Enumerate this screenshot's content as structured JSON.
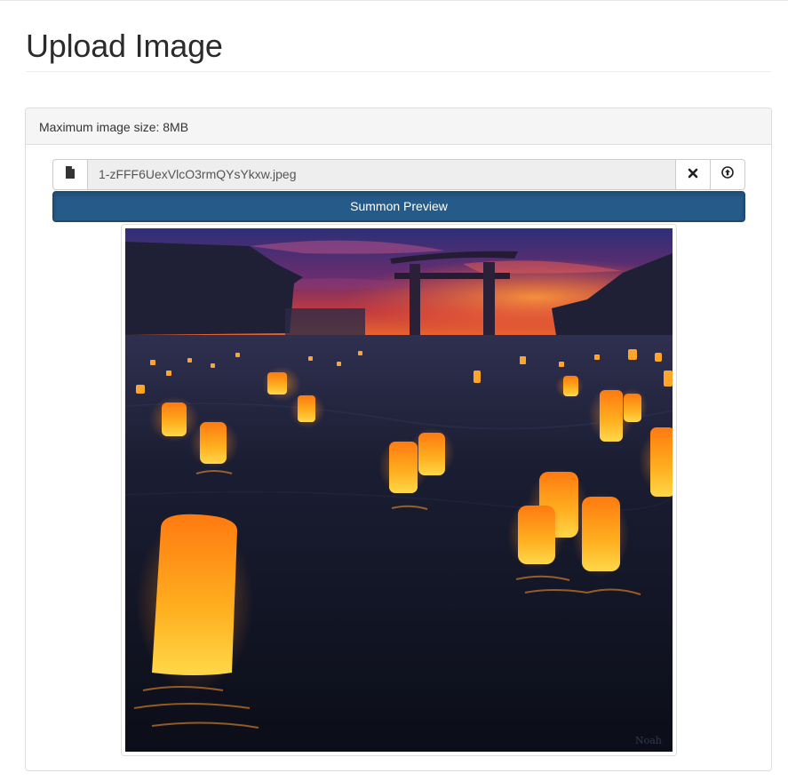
{
  "page": {
    "title": "Upload Image"
  },
  "panel": {
    "heading": "Maximum image size: 8MB"
  },
  "upload": {
    "file_icon": "file-icon",
    "file_name": "1-zFFF6UexVlcO3rmQYsYkxw.jpeg",
    "clear_icon": "close-icon",
    "upload_icon": "upload-circle-icon",
    "preview_button": "Summon Preview"
  },
  "preview": {
    "image_subject": "torii gate at sunset over water with floating lanterns",
    "signature": "Noah"
  },
  "colors": {
    "primary_button": "#265a88",
    "panel_heading_bg": "#f5f5f5",
    "border": "#dddddd",
    "filename_bg": "#eeeeee"
  }
}
